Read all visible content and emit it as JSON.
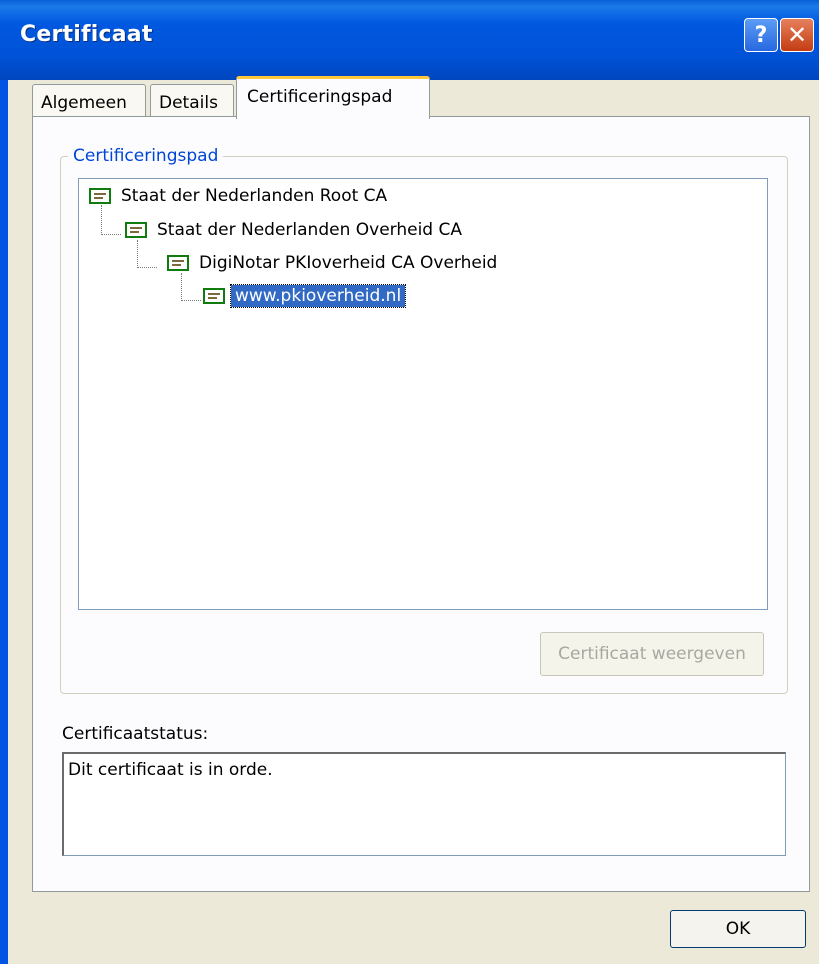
{
  "window": {
    "title": "Certificaat",
    "help_glyph": "?",
    "close_glyph": "✕"
  },
  "tabs": [
    {
      "label": "Algemeen"
    },
    {
      "label": "Details"
    },
    {
      "label": "Certificeringspad"
    }
  ],
  "path_group": {
    "legend": "Certificeringspad",
    "nodes": [
      {
        "label": "Staat der Nederlanden Root CA",
        "icon": "certificate-icon"
      },
      {
        "label": "Staat der Nederlanden Overheid CA",
        "icon": "certificate-icon"
      },
      {
        "label": "DigiNotar PKIoverheid CA Overheid",
        "icon": "certificate-icon"
      },
      {
        "label": "www.pkioverheid.nl",
        "icon": "certificate-icon",
        "selected": true
      }
    ],
    "view_button": "Certificaat weergeven"
  },
  "status": {
    "label": "Certificaatstatus:",
    "text": "Dit certificaat is in orde."
  },
  "footer": {
    "ok_label": "OK"
  },
  "colors": {
    "titlebar": "#0058e0",
    "dialog_bg": "#ece9d8",
    "selection": "#316ac5",
    "active_tab_accent": "#ffc73c",
    "group_legend": "#0046d5"
  }
}
